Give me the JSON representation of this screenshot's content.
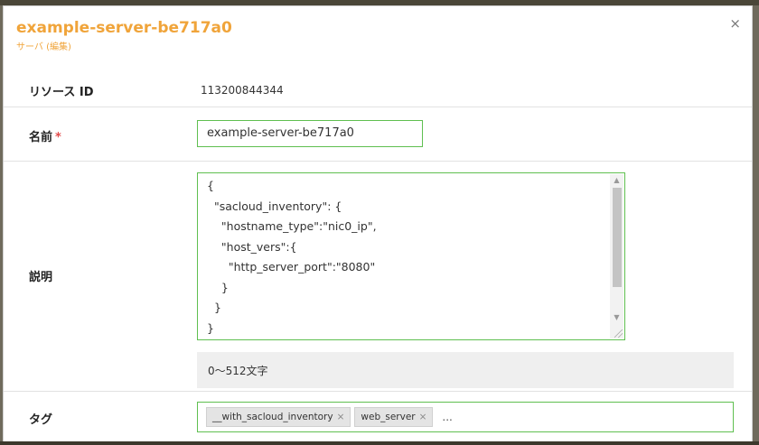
{
  "dialog": {
    "title": "example-server-be717a0",
    "subtitle": "サーバ (編集)",
    "close_icon": "×"
  },
  "fields": {
    "resource_id": {
      "label": "リソース ID",
      "value": "113200844344"
    },
    "name": {
      "label": "名前",
      "required_mark": "*",
      "value": "example-server-be717a0"
    },
    "description": {
      "label": "説明",
      "value": "{\n  \"sacloud_inventory\": {\n    \"hostname_type\":\"nic0_ip\",\n    \"host_vers\":{\n      \"http_server_port\":\"8080\"\n    }\n  }\n}",
      "hint": "0〜512文字"
    },
    "tags": {
      "label": "タグ",
      "items": [
        {
          "text": "__with_sacloud_inventory",
          "remove": "×"
        },
        {
          "text": "web_server",
          "remove": "×"
        }
      ],
      "more": "..."
    }
  },
  "colors": {
    "accent": "#f0a43a",
    "valid_border": "#5fbf50",
    "required": "#e24a4a"
  }
}
